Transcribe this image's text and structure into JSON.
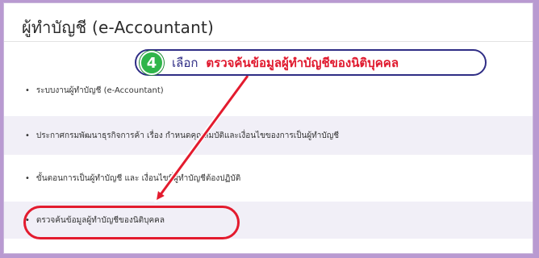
{
  "page": {
    "title": "ผู้ทำบัญชี (e-Accountant)"
  },
  "callout": {
    "step_number": "4",
    "prefix": "เลือก",
    "link_text": "ตรวจค้นข้อมูลผู้ทำบัญชีของนิติบุคคล"
  },
  "menu": {
    "bullet": "•",
    "items": [
      {
        "label": "ระบบงานผู้ทำบัญชี (e-Accountant)"
      },
      {
        "label": "ประกาศกรมพัฒนาธุรกิจการค้า เรื่อง กำหนดคุณสมบัติและเงื่อนไขของการเป็นผู้ทำบัญชี"
      },
      {
        "label": "ขั้นตอนการเป็นผู้ทำบัญชี และ เงื่อนไขที่ผู้ทำบัญชีต้องปฏิบัติ"
      },
      {
        "label": "ตรวจค้นข้อมูลผู้ทำบัญชีของนิติบุคคล"
      }
    ]
  },
  "colors": {
    "accent_red": "#e31b2e",
    "navy": "#2f2d85",
    "badge_green": "#2fb54a",
    "frame_purple": "#b99ad1"
  }
}
